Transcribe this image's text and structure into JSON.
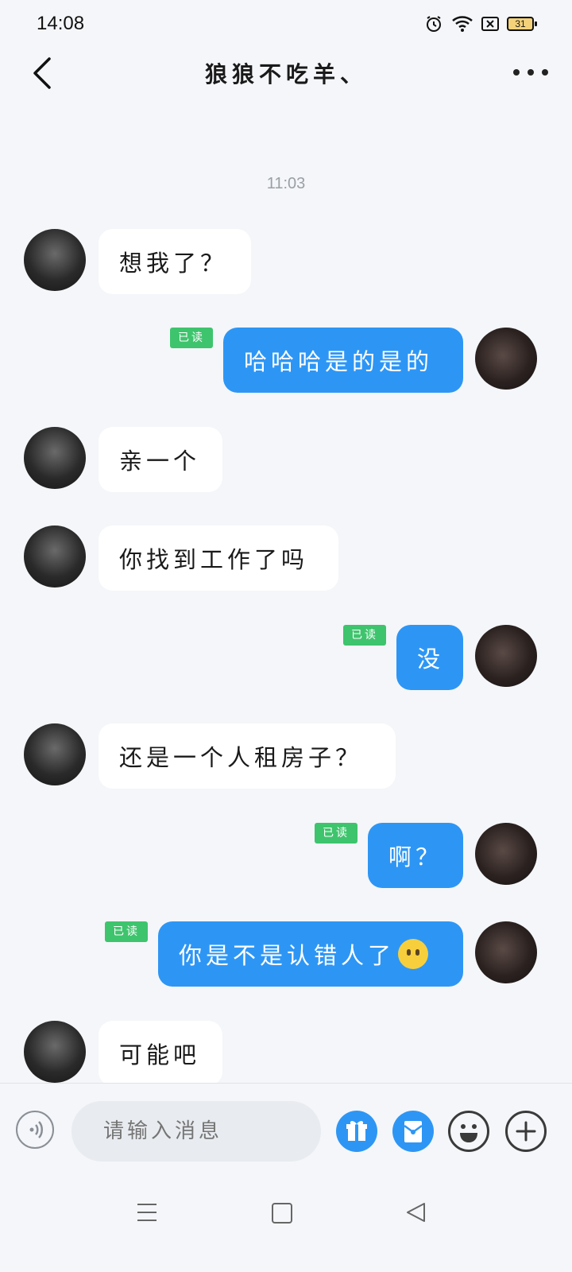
{
  "status_bar": {
    "time": "14:08",
    "battery": "31",
    "icons": [
      "alarm-icon",
      "wifi-icon",
      "no-sim-icon",
      "battery-icon"
    ]
  },
  "header": {
    "title": "狼狼不吃羊、",
    "back_icon": "chevron-left-icon",
    "more_icon": "more-horizontal-icon"
  },
  "chat": {
    "timestamp": "11:03",
    "read_label": "已读",
    "messages": [
      {
        "from": "peer",
        "text": "想我了？"
      },
      {
        "from": "me",
        "text": "哈哈哈是的是的",
        "read": true
      },
      {
        "from": "peer",
        "text": "亲一个"
      },
      {
        "from": "peer",
        "text": "你找到工作了吗"
      },
      {
        "from": "me",
        "text": "没",
        "read": true
      },
      {
        "from": "peer",
        "text": "还是一个人租房子？"
      },
      {
        "from": "me",
        "text": "啊？",
        "read": true
      },
      {
        "from": "me",
        "text": "你是不是认错人了",
        "emoji": "neutral-face-emoji",
        "read": true
      },
      {
        "from": "peer",
        "text": "可能吧"
      }
    ]
  },
  "input_bar": {
    "placeholder": "请输入消息",
    "buttons": [
      "voice-icon",
      "gift-icon",
      "red-packet-icon",
      "emoji-icon",
      "plus-icon"
    ]
  },
  "colors": {
    "background": "#f4f6f9",
    "my_bubble": "#2d96f5",
    "peer_bubble": "#ffffff",
    "read_badge": "#3ec46d"
  }
}
